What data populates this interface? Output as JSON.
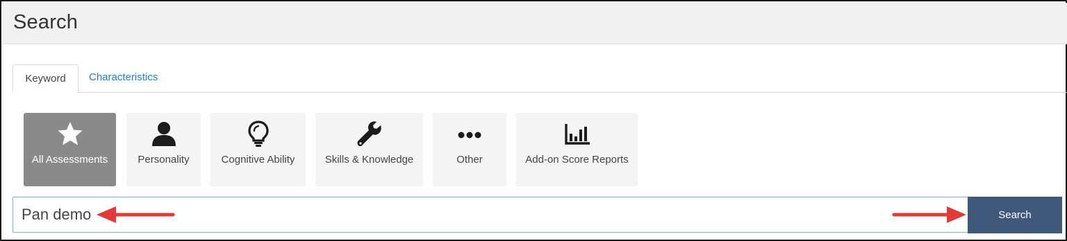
{
  "header": {
    "title": "Search"
  },
  "tabs": [
    {
      "label": "Keyword",
      "active": true
    },
    {
      "label": "Characteristics",
      "active": false
    }
  ],
  "categories": [
    {
      "label": "All Assessments",
      "icon": "star-icon",
      "active": true
    },
    {
      "label": "Personality",
      "icon": "person-icon",
      "active": false
    },
    {
      "label": "Cognitive Ability",
      "icon": "lightbulb-icon",
      "active": false
    },
    {
      "label": "Skills & Knowledge",
      "icon": "wrench-icon",
      "active": false
    },
    {
      "label": "Other",
      "icon": "ellipsis-icon",
      "active": false
    },
    {
      "label": "Add-on Score Reports",
      "icon": "bar-chart-icon",
      "active": false
    }
  ],
  "search": {
    "value": "Pan demo",
    "button_label": "Search"
  },
  "colors": {
    "header_bg": "#f1f1f1",
    "active_tile": "#8a8a8a",
    "tile_bg": "#f4f4f4",
    "link": "#1a7fd0",
    "search_button": "#3f5778",
    "annotation_arrow": "#e53935"
  }
}
